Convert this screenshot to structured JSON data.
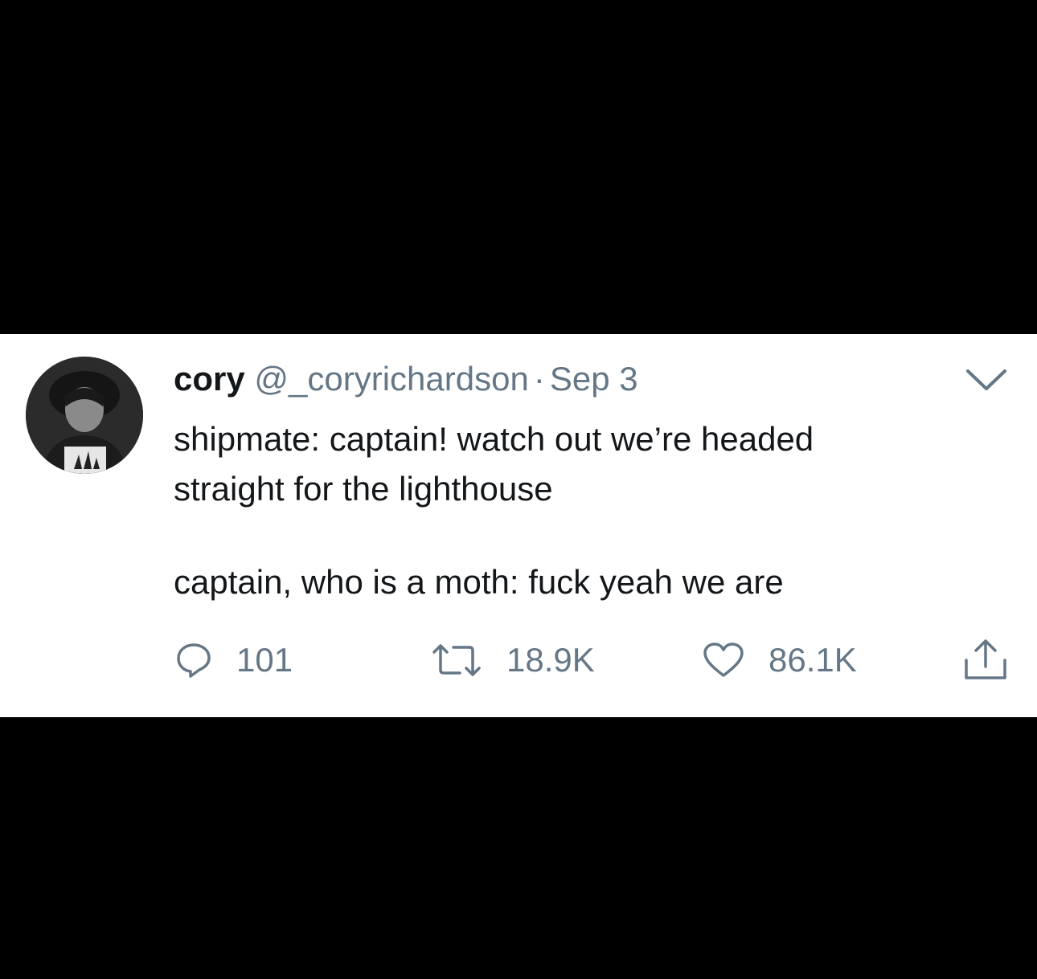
{
  "tweet": {
    "display_name": "cory",
    "handle": "@_coryrichardson",
    "separator": "·",
    "date": "Sep 3",
    "text_lines": [
      "shipmate: captain! watch out we’re headed",
      "straight for the lighthouse"
    ],
    "text_line_2": "captain, who is a moth: fuck yeah we are",
    "avatar_icon": "profile-photo",
    "menu_icon": "chevron-down-icon"
  },
  "actions": {
    "reply_count": "101",
    "retweet_count": "18.9K",
    "like_count": "86.1K",
    "reply_icon": "reply-icon",
    "retweet_icon": "retweet-icon",
    "like_icon": "heart-icon",
    "share_icon": "share-icon"
  },
  "colors": {
    "background": "#000000",
    "card": "#ffffff",
    "text_primary": "#14171a",
    "text_secondary": "#657786"
  }
}
